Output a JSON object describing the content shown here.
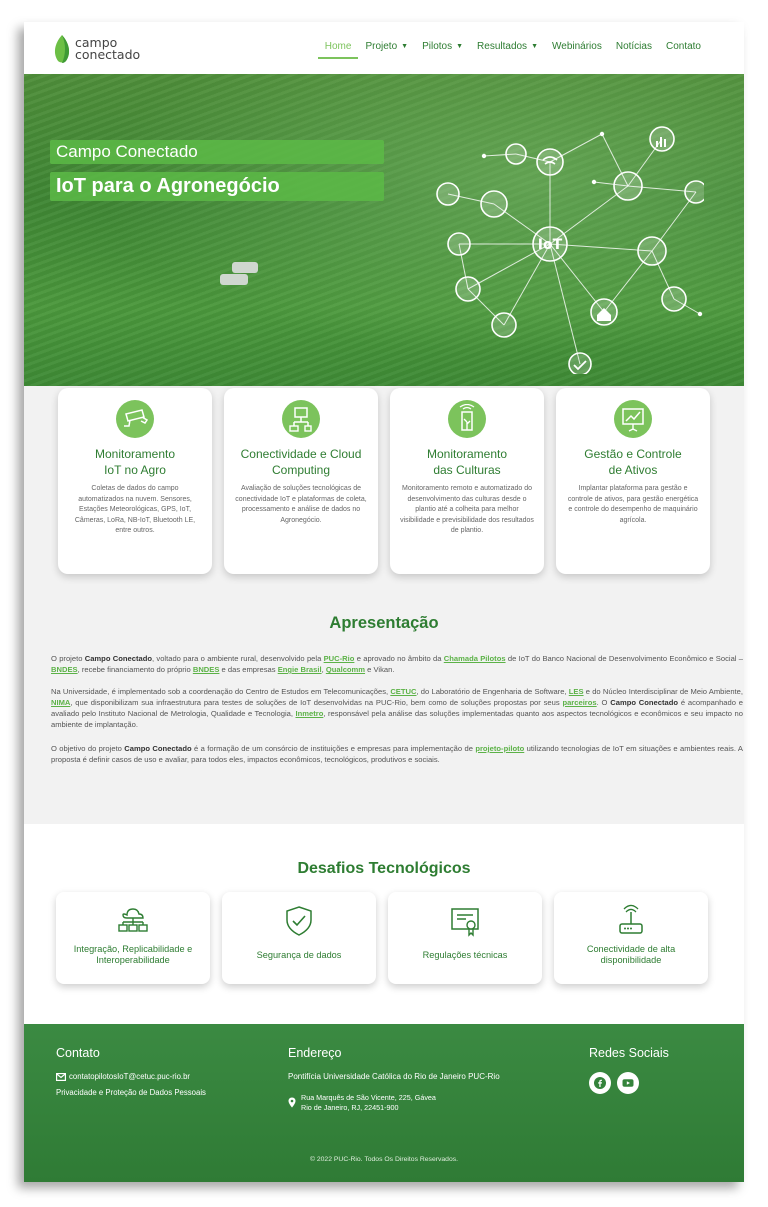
{
  "brand": {
    "line1": "campo",
    "line2": "conectado"
  },
  "nav": [
    {
      "label": "Home",
      "dropdown": false,
      "active": true
    },
    {
      "label": "Projeto",
      "dropdown": true
    },
    {
      "label": "Pilotos",
      "dropdown": true
    },
    {
      "label": "Resultados",
      "dropdown": true
    },
    {
      "label": "Webinários",
      "dropdown": false
    },
    {
      "label": "Notícias",
      "dropdown": false
    },
    {
      "label": "Contato",
      "dropdown": false
    }
  ],
  "hero": {
    "subtitle": "Campo Conectado",
    "title": "IoT para o Agronegócio",
    "iot_label": "IoT"
  },
  "features": [
    {
      "icon": "security-camera-icon",
      "title_1": "Monitoramento",
      "title_2": "IoT no Agro",
      "desc": "Coletas de dados do campo automatizados na nuvem. Sensores, Estações Meteorológicas, GPS, IoT, Câmeras, LoRa, NB-IoT, Bluetooth LE, entre outros."
    },
    {
      "icon": "network-devices-icon",
      "title_1": "Conectividade e Cloud",
      "title_2": "Computing",
      "desc": "Avaliação de soluções tecnológicas de conectividade IoT e plataformas de coleta, processamento e análise de dados no Agronegócio."
    },
    {
      "icon": "crop-sensor-icon",
      "title_1": "Monitoramento",
      "title_2": "das Culturas",
      "desc": "Monitoramento remoto e automatizado do desenvolvimento das culturas desde o plantio até a colheita para melhor visibilidade e previsibilidade dos resultados de plantio."
    },
    {
      "icon": "chart-board-icon",
      "title_1": "Gestão e Controle",
      "title_2": "de Ativos",
      "desc": "Implantar plataforma para gestão e controle de ativos, para gestão energética e controle do desempenho de maquinário agrícola."
    }
  ],
  "apresentacao": {
    "title": "Apresentação",
    "p1": [
      {
        "t": "O projeto "
      },
      {
        "t": "Campo Conectado",
        "b": true
      },
      {
        "t": ", voltado para o ambiente rural, desenvolvido pela "
      },
      {
        "t": "PUC-Rio",
        "a": true
      },
      {
        "t": " e aprovado no âmbito da "
      },
      {
        "t": "Chamada Pilotos",
        "a": true
      },
      {
        "t": " de IoT do Banco Nacional de Desenvolvimento Econômico e Social – "
      },
      {
        "t": "BNDES",
        "a": true
      },
      {
        "t": ", recebe financiamento do próprio "
      },
      {
        "t": "BNDES",
        "a": true
      },
      {
        "t": " e das empresas "
      },
      {
        "t": "Engie Brasil",
        "a": true
      },
      {
        "t": ",  "
      },
      {
        "t": "Qualcomm",
        "a": true
      },
      {
        "t": " e Vikan."
      }
    ],
    "p2": [
      {
        "t": "Na Universidade, é implementado sob a coordenação do Centro de Estudos em Telecomunicações, "
      },
      {
        "t": "CETUC",
        "a": true
      },
      {
        "t": ", do Laboratório de Engenharia de Software, "
      },
      {
        "t": "LES",
        "a": true
      },
      {
        "t": " e do Núcleo Interdisciplinar de Meio Ambiente, "
      },
      {
        "t": "NIMA",
        "a": true
      },
      {
        "t": ", que disponibilizam sua infraestrutura para testes de soluções de IoT desenvolvidas na PUC-Rio, bem como de soluções propostas por seus "
      },
      {
        "t": "parceiros",
        "a": true
      },
      {
        "t": ". O "
      },
      {
        "t": "Campo Conectado",
        "b": true
      },
      {
        "t": " é acompanhado e avaliado pelo Instituto Nacional de Metrologia, Qualidade e Tecnologia, "
      },
      {
        "t": "Inmetro",
        "a": true
      },
      {
        "t": ", responsável pela análise das soluções implementadas quanto aos aspectos tecnológicos e econômicos e seu impacto no ambiente de implantação."
      }
    ],
    "p3": [
      {
        "t": "O objetivo do projeto "
      },
      {
        "t": "Campo Conectado",
        "b": true
      },
      {
        "t": " é a formação de um consórcio de instituições e empresas para implementação de "
      },
      {
        "t": "projeto-piloto",
        "a": true
      },
      {
        "t": " utilizando tecnologias de IoT em situações e ambientes reais. A proposta é definir casos de uso e avaliar, para todos eles, impactos econômicos, tecnológicos, produtivos e sociais."
      }
    ]
  },
  "desafios": {
    "title": "Desafios Tecnológicos",
    "cards": [
      {
        "icon": "cloud-network-icon",
        "line1": "Integração, Replicabilidade e",
        "line2": "Interoperabilidade"
      },
      {
        "icon": "shield-check-icon",
        "line1": "Segurança de dados",
        "line2": ""
      },
      {
        "icon": "certificate-icon",
        "line1": "Regulações técnicas",
        "line2": ""
      },
      {
        "icon": "router-icon",
        "line1": "Conectividade de alta",
        "line2": "disponibilidade"
      }
    ]
  },
  "footer": {
    "contato_title": "Contato",
    "email": "contatopilotosIoT@cetuc.puc-rio.br",
    "privacy": "Privacidade e Proteção de Dados Pessoais",
    "endereco_title": "Endereço",
    "institution": "Pontifícia Universidade Católica do Rio de Janeiro PUC-Rio",
    "address_1": "Rua Marquês de São Vicente, 225, Gávea",
    "address_2": "Rio de Janeiro, RJ, 22451-900",
    "social_title": "Redes Sociais",
    "social": [
      "facebook-icon",
      "youtube-icon"
    ],
    "copyright": "© 2022 PUC-Rio. Todos Os Direitos Reservados."
  },
  "colors": {
    "primary": "#2e7d32",
    "accent": "#7cc35c",
    "link": "#5cb247",
    "footer": "#34833b"
  }
}
